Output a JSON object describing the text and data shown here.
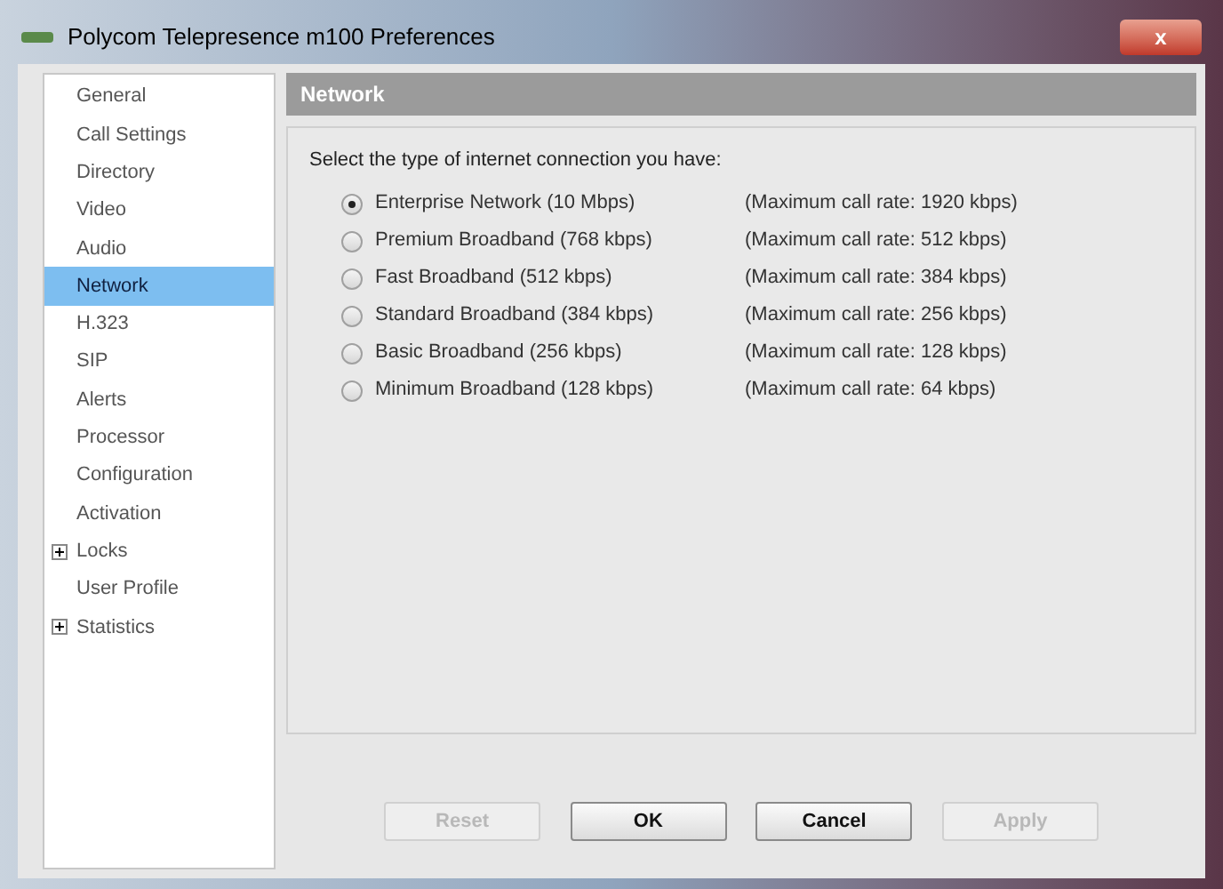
{
  "window": {
    "title": "Polycom Telepresence m100 Preferences",
    "close": "x"
  },
  "sidebar": {
    "items": [
      {
        "label": "General",
        "kind": "leaf",
        "selected": false
      },
      {
        "label": "Call Settings",
        "kind": "leaf",
        "selected": false
      },
      {
        "label": "Directory",
        "kind": "leaf",
        "selected": false
      },
      {
        "label": "Video",
        "kind": "leaf",
        "selected": false
      },
      {
        "label": "Audio",
        "kind": "leaf",
        "selected": false
      },
      {
        "label": "Network",
        "kind": "leaf",
        "selected": true
      },
      {
        "label": "H.323",
        "kind": "leaf",
        "selected": false
      },
      {
        "label": "SIP",
        "kind": "leaf",
        "selected": false
      },
      {
        "label": "Alerts",
        "kind": "leaf",
        "selected": false
      },
      {
        "label": "Processor",
        "kind": "leaf",
        "selected": false
      },
      {
        "label": "Configuration",
        "kind": "leaf",
        "selected": false
      },
      {
        "label": "Activation",
        "kind": "leaf",
        "selected": false
      },
      {
        "label": "Locks",
        "kind": "group",
        "selected": false
      },
      {
        "label": "User Profile",
        "kind": "leaf",
        "selected": false
      },
      {
        "label": "Statistics",
        "kind": "group",
        "selected": false
      }
    ]
  },
  "panel": {
    "title": "Network",
    "prompt": "Select the type of internet connection you have:",
    "options": [
      {
        "label": "Enterprise Network (10 Mbps)",
        "rate": "(Maximum call rate: 1920 kbps)",
        "selected": true
      },
      {
        "label": "Premium Broadband (768 kbps)",
        "rate": "(Maximum call rate: 512 kbps)",
        "selected": false
      },
      {
        "label": "Fast Broadband (512 kbps)",
        "rate": "(Maximum call rate: 384 kbps)",
        "selected": false
      },
      {
        "label": "Standard Broadband (384 kbps)",
        "rate": "(Maximum call rate: 256 kbps)",
        "selected": false
      },
      {
        "label": "Basic Broadband (256 kbps)",
        "rate": "(Maximum call rate: 128 kbps)",
        "selected": false
      },
      {
        "label": "Minimum Broadband (128 kbps)",
        "rate": "(Maximum call rate: 64 kbps)",
        "selected": false
      }
    ]
  },
  "buttons": [
    {
      "label": "Reset",
      "disabled": true
    },
    {
      "label": "OK",
      "disabled": false
    },
    {
      "label": "Cancel",
      "disabled": false
    },
    {
      "label": "Apply",
      "disabled": true
    }
  ]
}
